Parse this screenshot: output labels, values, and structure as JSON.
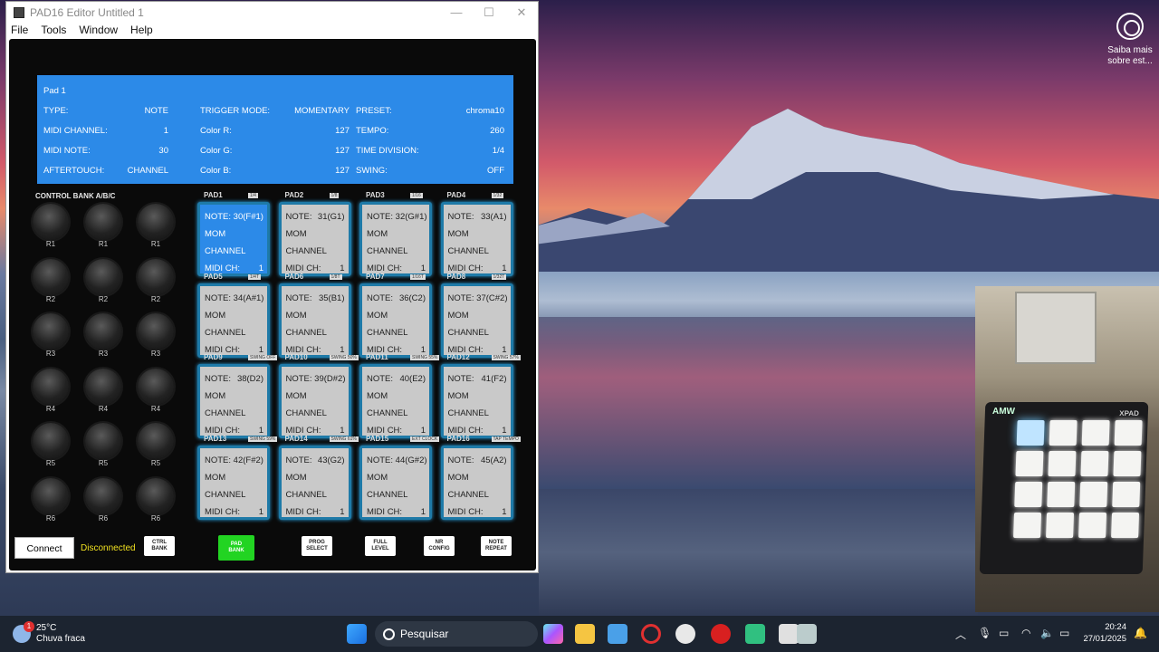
{
  "window": {
    "title": "PAD16 Editor Untitled 1",
    "controls": [
      "—",
      "☐",
      "✕"
    ]
  },
  "menu": [
    "File",
    "Tools",
    "Window",
    "Help"
  ],
  "info": {
    "title": "Pad 1",
    "rows": [
      [
        "TYPE:",
        "NOTE",
        "TRIGGER MODE:",
        "MOMENTARY",
        "PRESET:",
        "chroma10"
      ],
      [
        "MIDI CHANNEL:",
        "1",
        "Color R:",
        "127",
        "TEMPO:",
        "260"
      ],
      [
        "MIDI NOTE:",
        "30",
        "Color G:",
        "127",
        "TIME DIVISION:",
        "1/4"
      ],
      [
        "AFTERTOUCH:",
        "CHANNEL",
        "Color B:",
        "127",
        "SWING:",
        "OFF"
      ]
    ]
  },
  "control_bank": {
    "title": "CONTROL BANK A/B/C",
    "rows": [
      [
        "R1",
        "R1",
        "R1"
      ],
      [
        "R2",
        "R2",
        "R2"
      ],
      [
        "R3",
        "R3",
        "R3"
      ],
      [
        "R4",
        "R4",
        "R4"
      ],
      [
        "R5",
        "R5",
        "R5"
      ],
      [
        "R6",
        "R6",
        "R6"
      ]
    ]
  },
  "pads": [
    {
      "label": "PAD1",
      "tag": "1/4",
      "note": "NOTE: 30(F#1)",
      "mode": "MOM",
      "at": "CHANNEL",
      "ch": "MIDI CH:",
      "chv": "1",
      "selected": true
    },
    {
      "label": "PAD2",
      "tag": "1/8",
      "note": "NOTE:",
      "notev": "31(G1)",
      "mode": "MOM",
      "at": "CHANNEL",
      "ch": "MIDI CH:",
      "chv": "1"
    },
    {
      "label": "PAD3",
      "tag": "1/16",
      "note": "NOTE: 32(G#1)",
      "mode": "MOM",
      "at": "CHANNEL",
      "ch": "MIDI CH:",
      "chv": "1"
    },
    {
      "label": "PAD4",
      "tag": "1/32",
      "note": "NOTE:",
      "notev": "33(A1)",
      "mode": "MOM",
      "at": "CHANNEL",
      "ch": "MIDI CH:",
      "chv": "1"
    },
    {
      "label": "PAD5",
      "tag": "1/4T",
      "note": "NOTE: 34(A#1)",
      "mode": "MOM",
      "at": "CHANNEL",
      "ch": "MIDI CH:",
      "chv": "1"
    },
    {
      "label": "PAD6",
      "tag": "1/8T",
      "note": "NOTE:",
      "notev": "35(B1)",
      "mode": "MOM",
      "at": "CHANNEL",
      "ch": "MIDI CH:",
      "chv": "1"
    },
    {
      "label": "PAD7",
      "tag": "1/16T",
      "note": "NOTE:",
      "notev": "36(C2)",
      "mode": "MOM",
      "at": "CHANNEL",
      "ch": "MIDI CH:",
      "chv": "1"
    },
    {
      "label": "PAD8",
      "tag": "1/32T",
      "note": "NOTE: 37(C#2)",
      "mode": "MOM",
      "at": "CHANNEL",
      "ch": "MIDI CH:",
      "chv": "1"
    },
    {
      "label": "PAD9",
      "tag": "SWING OFF",
      "note": "NOTE:",
      "notev": "38(D2)",
      "mode": "MOM",
      "at": "CHANNEL",
      "ch": "MIDI CH:",
      "chv": "1"
    },
    {
      "label": "PAD10",
      "tag": "SWING 50%",
      "note": "NOTE: 39(D#2)",
      "mode": "MOM",
      "at": "CHANNEL",
      "ch": "MIDI CH:",
      "chv": "1"
    },
    {
      "label": "PAD11",
      "tag": "SWING 55%",
      "note": "NOTE:",
      "notev": "40(E2)",
      "mode": "MOM",
      "at": "CHANNEL",
      "ch": "MIDI CH:",
      "chv": "1"
    },
    {
      "label": "PAD12",
      "tag": "SWING 57%",
      "note": "NOTE:",
      "notev": "41(F2)",
      "mode": "MOM",
      "at": "CHANNEL",
      "ch": "MIDI CH:",
      "chv": "1"
    },
    {
      "label": "PAD13",
      "tag": "SWING 59%",
      "note": "NOTE: 42(F#2)",
      "mode": "MOM",
      "at": "CHANNEL",
      "ch": "MIDI CH:",
      "chv": "1"
    },
    {
      "label": "PAD14",
      "tag": "SWING 61%",
      "note": "NOTE:",
      "notev": "43(G2)",
      "mode": "MOM",
      "at": "CHANNEL",
      "ch": "MIDI CH:",
      "chv": "1"
    },
    {
      "label": "PAD15",
      "tag": "EXT CLOCK",
      "note": "NOTE: 44(G#2)",
      "mode": "MOM",
      "at": "CHANNEL",
      "ch": "MIDI CH:",
      "chv": "1"
    },
    {
      "label": "PAD16",
      "tag": "TAP TEMPO",
      "note": "NOTE:",
      "notev": "45(A2)",
      "mode": "MOM",
      "at": "CHANNEL",
      "ch": "MIDI CH:",
      "chv": "1"
    }
  ],
  "bottom": {
    "connect": "Connect",
    "status": "Disconnected",
    "buttons": [
      [
        "CTRL",
        "BANK"
      ],
      [
        "PAD",
        "BANK"
      ],
      [
        "PROG",
        "SELECT"
      ],
      [
        "FULL",
        "LEVEL"
      ],
      [
        "NR",
        "CONFIG"
      ],
      [
        "NOTE",
        "REPEAT"
      ]
    ]
  },
  "desktop_widget": {
    "text1": "Saiba mais",
    "text2": "sobre est..."
  },
  "webcam": {
    "brand": "AMW",
    "model": "XPAD"
  },
  "taskbar": {
    "temp": "25°C",
    "weather": "Chuva fraca",
    "badge": "1",
    "search": "Pesquisar",
    "time": "20:24",
    "date": "27/01/2025"
  },
  "colors": {
    "accent": "#2c8ae8",
    "status": "#f0e020",
    "active_button": "#22d422",
    "pad_border": "#1e7aa8"
  }
}
